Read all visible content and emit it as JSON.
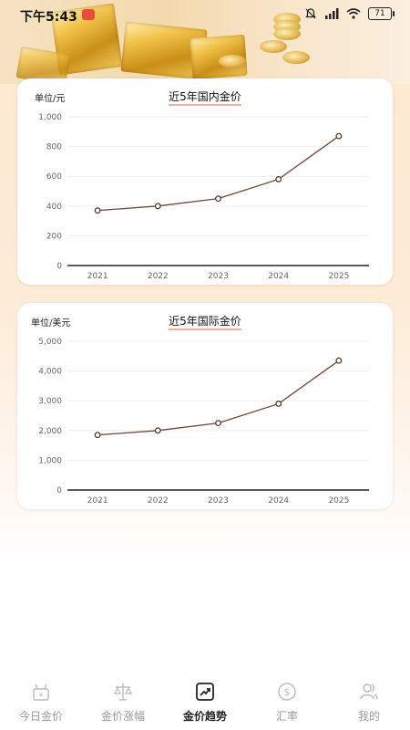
{
  "status_bar": {
    "time": "下午5:43",
    "battery": "71",
    "icons": [
      "mute-icon",
      "signal-icon",
      "wifi-icon",
      "battery-icon"
    ]
  },
  "colors": {
    "line": "#6a4a3a",
    "accent": "#e9b2a8",
    "active_nav": "#222222",
    "inactive_nav": "#9a9a9a"
  },
  "domestic": {
    "unit": "单位/元",
    "title": "近5年国内金价"
  },
  "international": {
    "unit": "单位/美元",
    "title": "近5年国际金价"
  },
  "chart_data": [
    {
      "type": "line",
      "title": "近5年国内金价",
      "ylabel": "单位/元",
      "x": [
        "2021",
        "2022",
        "2023",
        "2024",
        "2025"
      ],
      "y_ticks": [
        "0",
        "200",
        "400",
        "600",
        "800",
        "1,000"
      ],
      "ylim": [
        0,
        1000
      ],
      "values": [
        370,
        400,
        450,
        580,
        870
      ],
      "grid": true
    },
    {
      "type": "line",
      "title": "近5年国际金价",
      "ylabel": "单位/美元",
      "x": [
        "2021",
        "2022",
        "2023",
        "2024",
        "2025"
      ],
      "y_ticks": [
        "0",
        "1,000",
        "2,000",
        "3,000",
        "4,000",
        "5,000"
      ],
      "ylim": [
        0,
        5000
      ],
      "values": [
        1850,
        2000,
        2250,
        2900,
        4350
      ],
      "grid": true
    }
  ],
  "nav": {
    "items": [
      {
        "label": "今日金价",
        "icon": "gift-icon"
      },
      {
        "label": "金价涨幅",
        "icon": "scale-icon"
      },
      {
        "label": "金价趋势",
        "icon": "trend-chart-icon"
      },
      {
        "label": "汇率",
        "icon": "dollar-circle-icon"
      },
      {
        "label": "我的",
        "icon": "users-icon"
      }
    ],
    "active_index": 2
  }
}
